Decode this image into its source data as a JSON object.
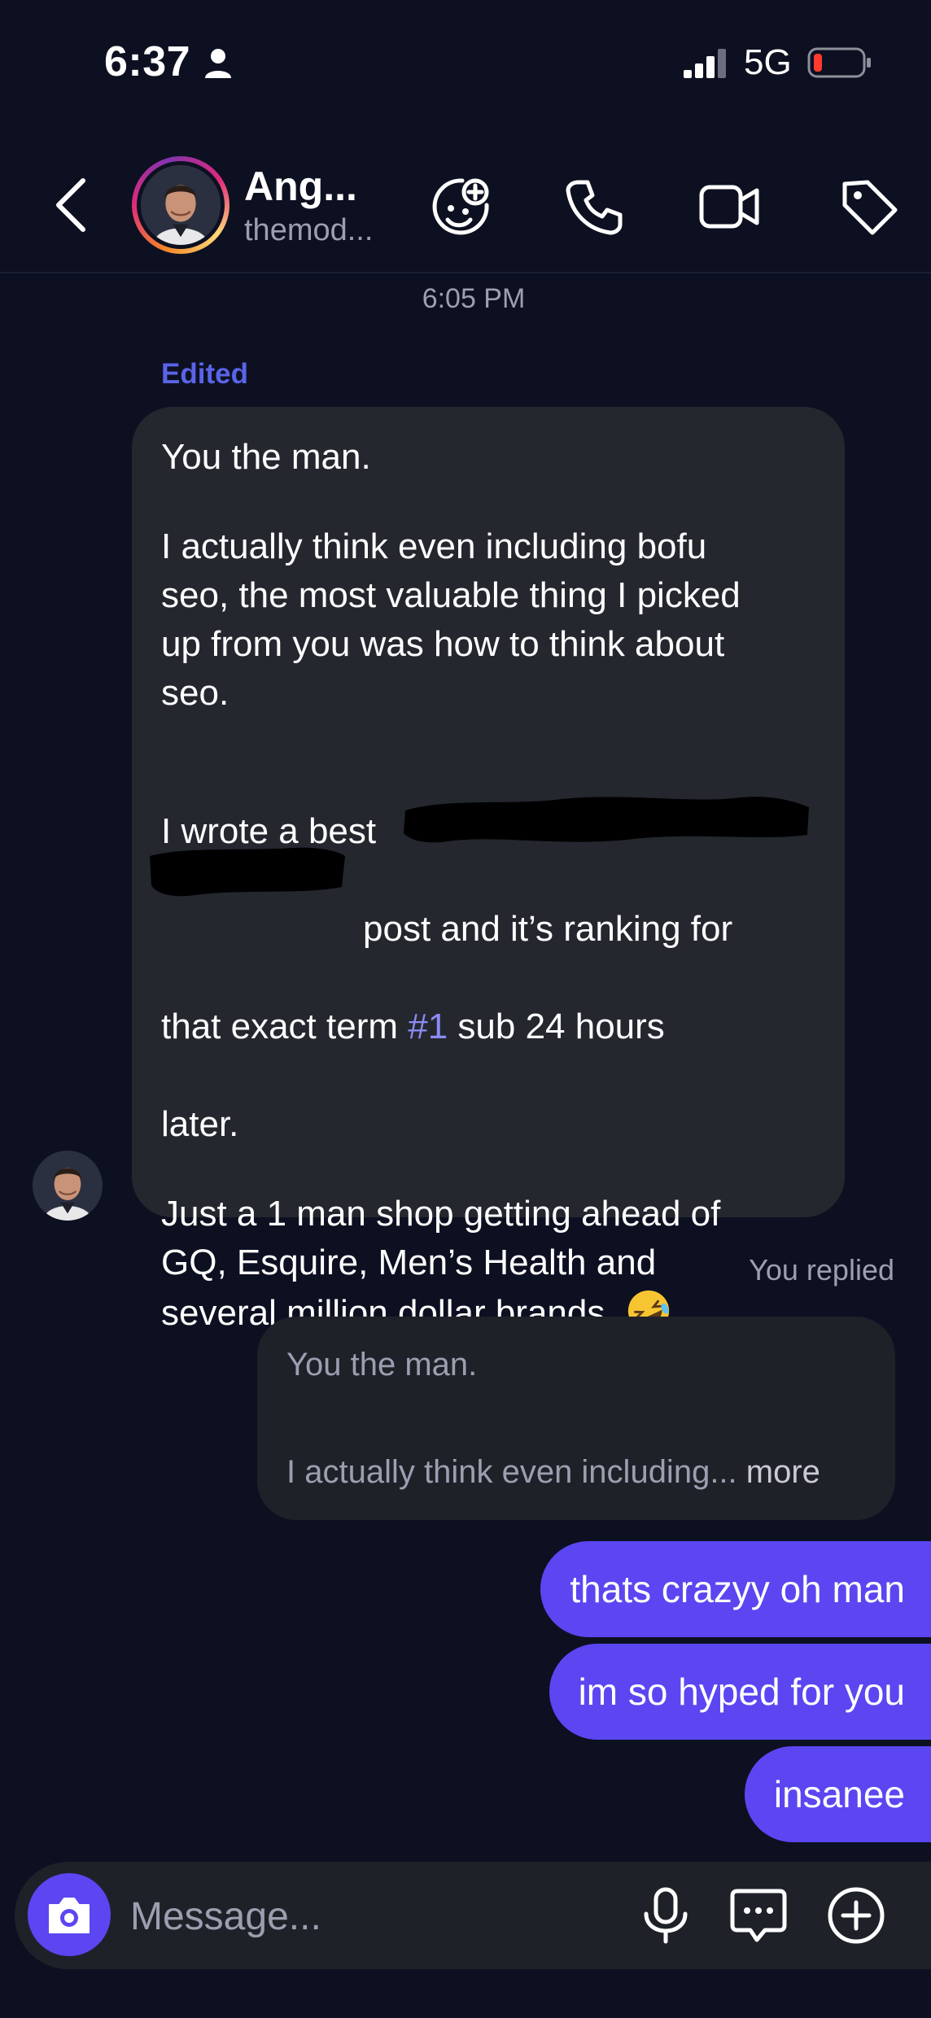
{
  "status_bar": {
    "time": "6:37",
    "network": "5G",
    "icons": [
      "person-icon",
      "signal-icon",
      "battery-icon"
    ]
  },
  "header": {
    "contact_name": "Ang...",
    "contact_handle": "themod...",
    "icons": [
      "back-icon",
      "sticker-icon",
      "phone-icon",
      "video-icon",
      "tag-icon"
    ]
  },
  "thread": {
    "timestamp": "6:05 PM",
    "incoming": {
      "edited_label": "Edited",
      "p1": "You the man.",
      "p2": "I actually think even including bofu\nseo, the most valuable thing I picked\nup from you was how to think about\nseo.",
      "p3_a": "I wrote a best",
      "p3_b": "post and it’s ranking for",
      "p3_c": "that exact term ",
      "p3_hashtag": "#1",
      "p3_d": " sub 24 hours",
      "p3_e": "later.",
      "p4": "Just a 1 man shop getting ahead of\nGQ, Esquire, Men’s Health and\nseveral million dollar brands. ",
      "emoji": "rolling-on-floor-laughing"
    },
    "you_replied_label": "You replied",
    "reply_preview": {
      "line1": "You the man.",
      "line2": "I actually think even including...",
      "more": " more"
    },
    "outgoing": [
      "thats crazyy oh man",
      "im so hyped for you",
      "insanee"
    ]
  },
  "composer": {
    "placeholder": "Message...",
    "icons": [
      "camera-icon",
      "microphone-icon",
      "chat-sticker-icon",
      "plus-icon"
    ]
  },
  "colors": {
    "background": "#0d1021",
    "incoming_bubble": "#25272f",
    "outgoing_bubble": "#5b46f2",
    "edited_label": "#5a64e8",
    "hashtag": "#8b8cf5"
  }
}
